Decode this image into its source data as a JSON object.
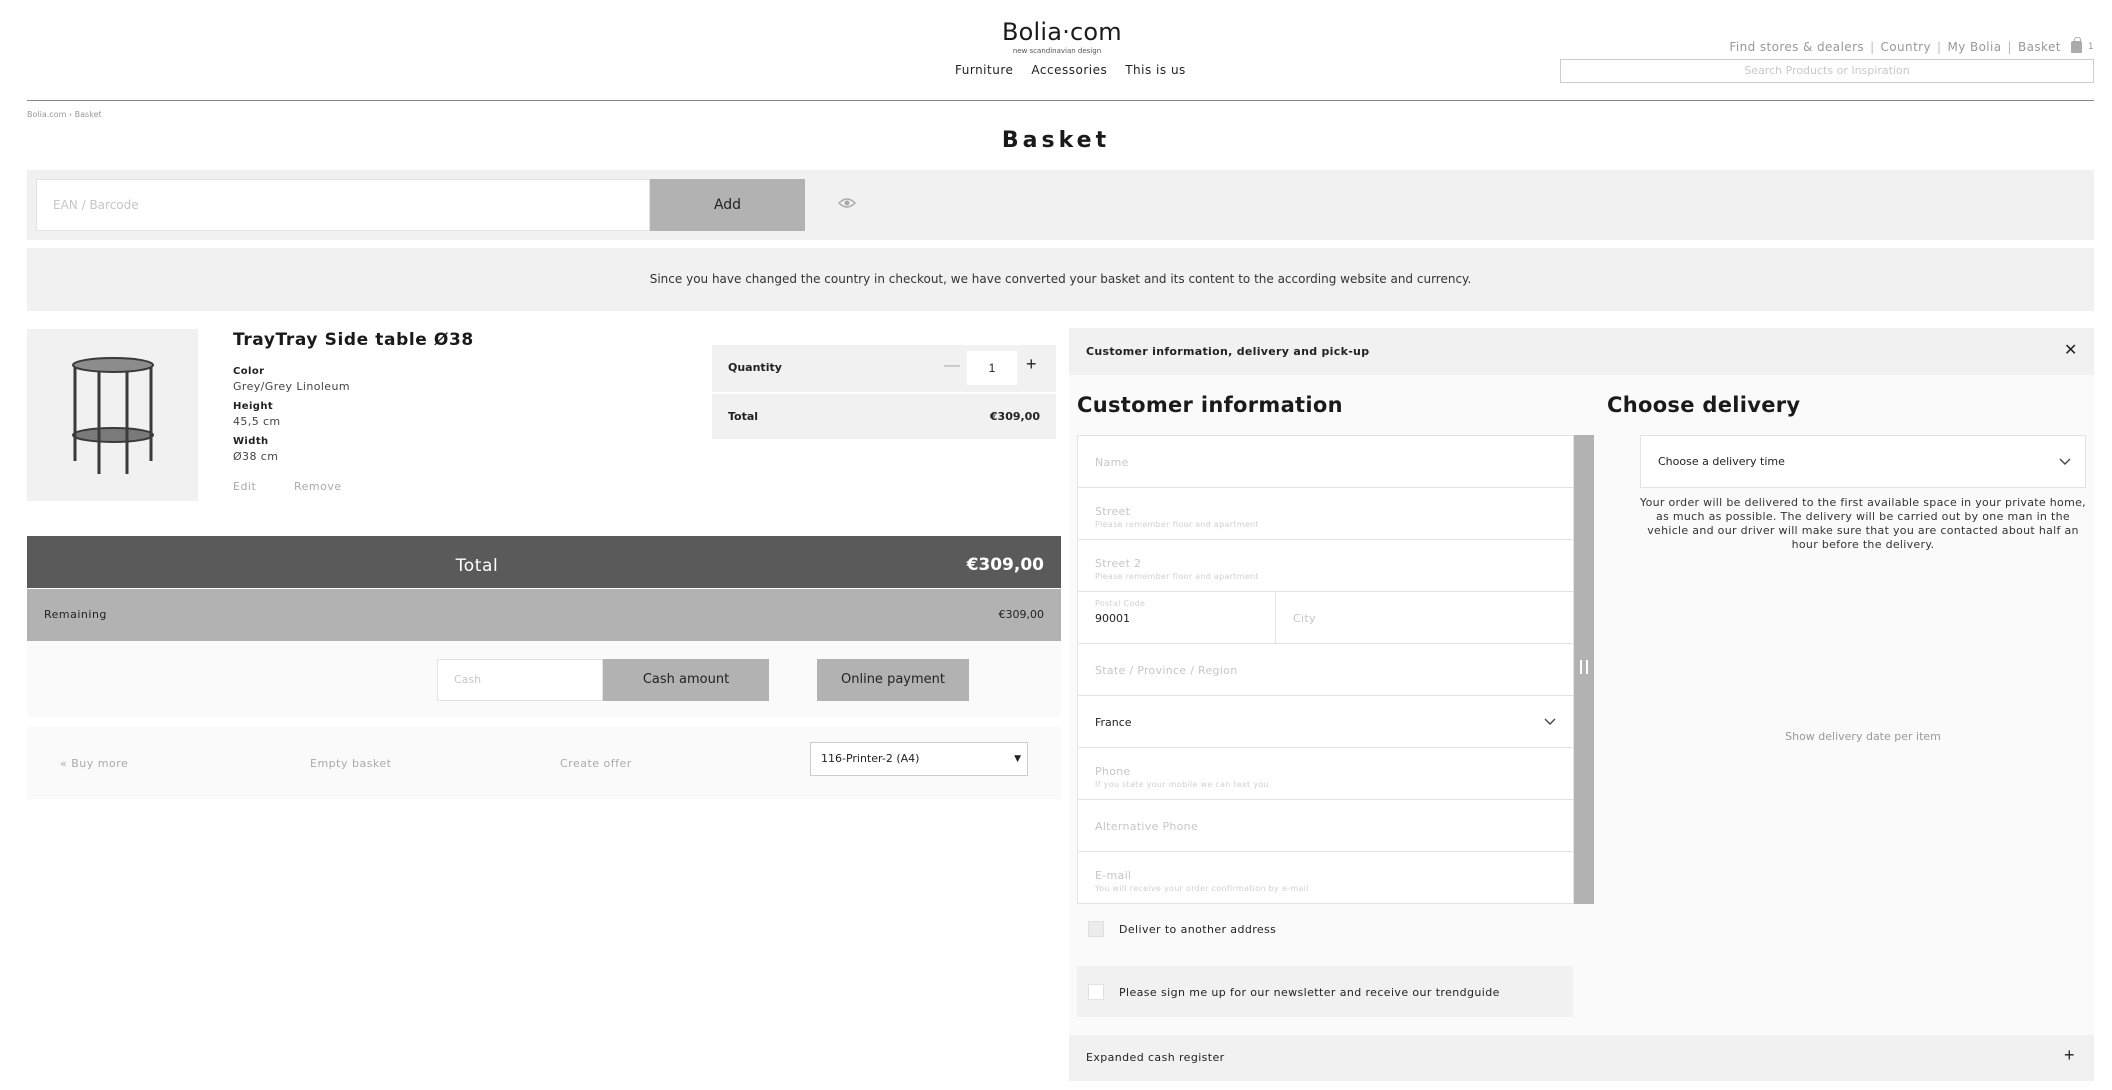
{
  "header": {
    "logo_main": "Bolia·com",
    "logo_sub": "new scandinavian design",
    "nav": [
      "Furniture",
      "Accessories",
      "This is us"
    ],
    "util": {
      "stores": "Find stores & dealers",
      "country": "Country",
      "my_bolia": "My Bolia",
      "basket": "Basket",
      "basket_count": "1",
      "separator": "|"
    },
    "search_placeholder": "Search Products or Inspiration"
  },
  "breadcrumb": {
    "home": "Bolia.com",
    "sep": "›",
    "current": "Basket"
  },
  "page_title": "Basket",
  "barcode": {
    "placeholder": "EAN / Barcode",
    "add_label": "Add"
  },
  "notice": "Since you have changed the country in checkout, we have converted your basket and its content to the according website and currency.",
  "product": {
    "name": "TrayTray Side table Ø38",
    "attributes": [
      {
        "label": "Color",
        "value": "Grey/Grey Linoleum"
      },
      {
        "label": "Height",
        "value": "45,5 cm"
      },
      {
        "label": "Width",
        "value": "Ø38 cm"
      }
    ],
    "edit_label": "Edit",
    "remove_label": "Remove",
    "quantity_label": "Quantity",
    "quantity": "1",
    "minus": "—",
    "plus": "+",
    "total_label": "Total",
    "total_value": "€309,00"
  },
  "totals": {
    "total_label": "Total",
    "total_value": "€309,00",
    "remaining_label": "Remaining",
    "remaining_value": "€309,00"
  },
  "payment": {
    "cash_placeholder": "Cash",
    "cash_button": "Cash amount",
    "online_button": "Online payment"
  },
  "actions": {
    "buy_more": "« Buy more",
    "empty": "Empty basket",
    "offer": "Create offer",
    "printer": "116-Printer-2 (A4)",
    "printer_caret": "▼"
  },
  "panel": {
    "header": "Customer information, delivery and pick-up",
    "close": "✕",
    "customer_title": "Customer information",
    "delivery_title": "Choose delivery",
    "fields": {
      "name": "Name",
      "street": "Street",
      "street_hint": "Please remember floor and apartment",
      "street2": "Street 2",
      "street2_hint": "Please remember floor and apartment",
      "postal_label": "Postal Code",
      "postal_value": "90001",
      "city": "City",
      "state": "State / Province / Region",
      "country": "France",
      "phone": "Phone",
      "phone_hint": "If you state your mobile we can text you",
      "alt_phone": "Alternative Phone",
      "email": "E-mail",
      "email_hint": "You will receive your order confirmation by e-mail"
    },
    "deliver_other": "Deliver to another address",
    "newsletter": "Please sign me up for our newsletter and receive our trendguide",
    "delivery_select": "Choose a delivery time",
    "delivery_text": "Your order will be delivered to the first available space in your private home, as much as possible. The delivery will be carried out by one man in the vehicle and our driver will make sure that you are contacted about half an hour before the delivery.",
    "delivery_link": "Show delivery date per item",
    "expanded_label": "Expanded cash register",
    "expanded_plus": "+"
  }
}
